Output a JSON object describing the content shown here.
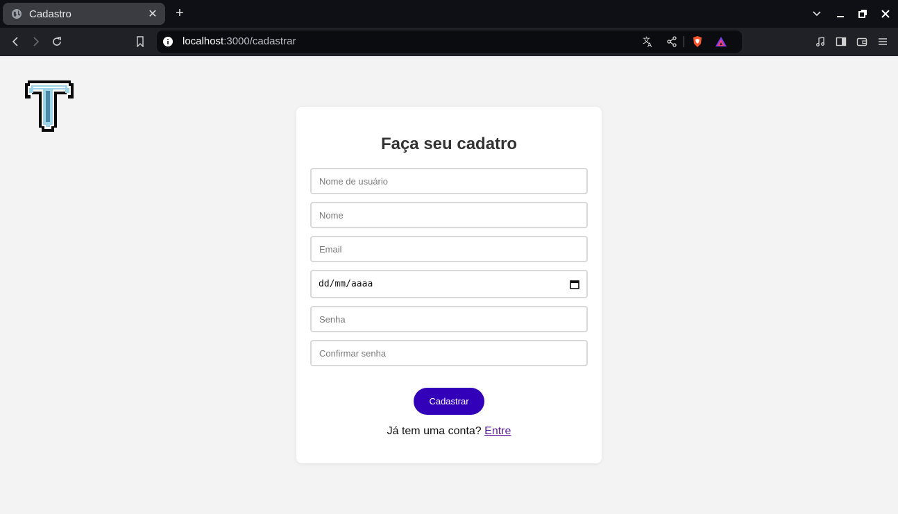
{
  "browser": {
    "tab_title": "Cadastro",
    "tab_close": "✕",
    "new_tab": "+",
    "url_host": "localhost",
    "url_path": ":3000/cadastrar"
  },
  "page": {
    "title": "Faça seu cadatro",
    "fields": {
      "username_placeholder": "Nome de usuário",
      "name_placeholder": "Nome",
      "email_placeholder": "Email",
      "date_value": "dd/mm/aaaa",
      "password_placeholder": "Senha",
      "confirm_password_placeholder": "Confirmar senha"
    },
    "submit_label": "Cadastrar",
    "login_prompt": "Já tem uma conta?",
    "login_link": "Entre"
  },
  "colors": {
    "accent": "#3200b8",
    "link": "#5b1a9a",
    "page_bg": "#f3f3f3"
  }
}
